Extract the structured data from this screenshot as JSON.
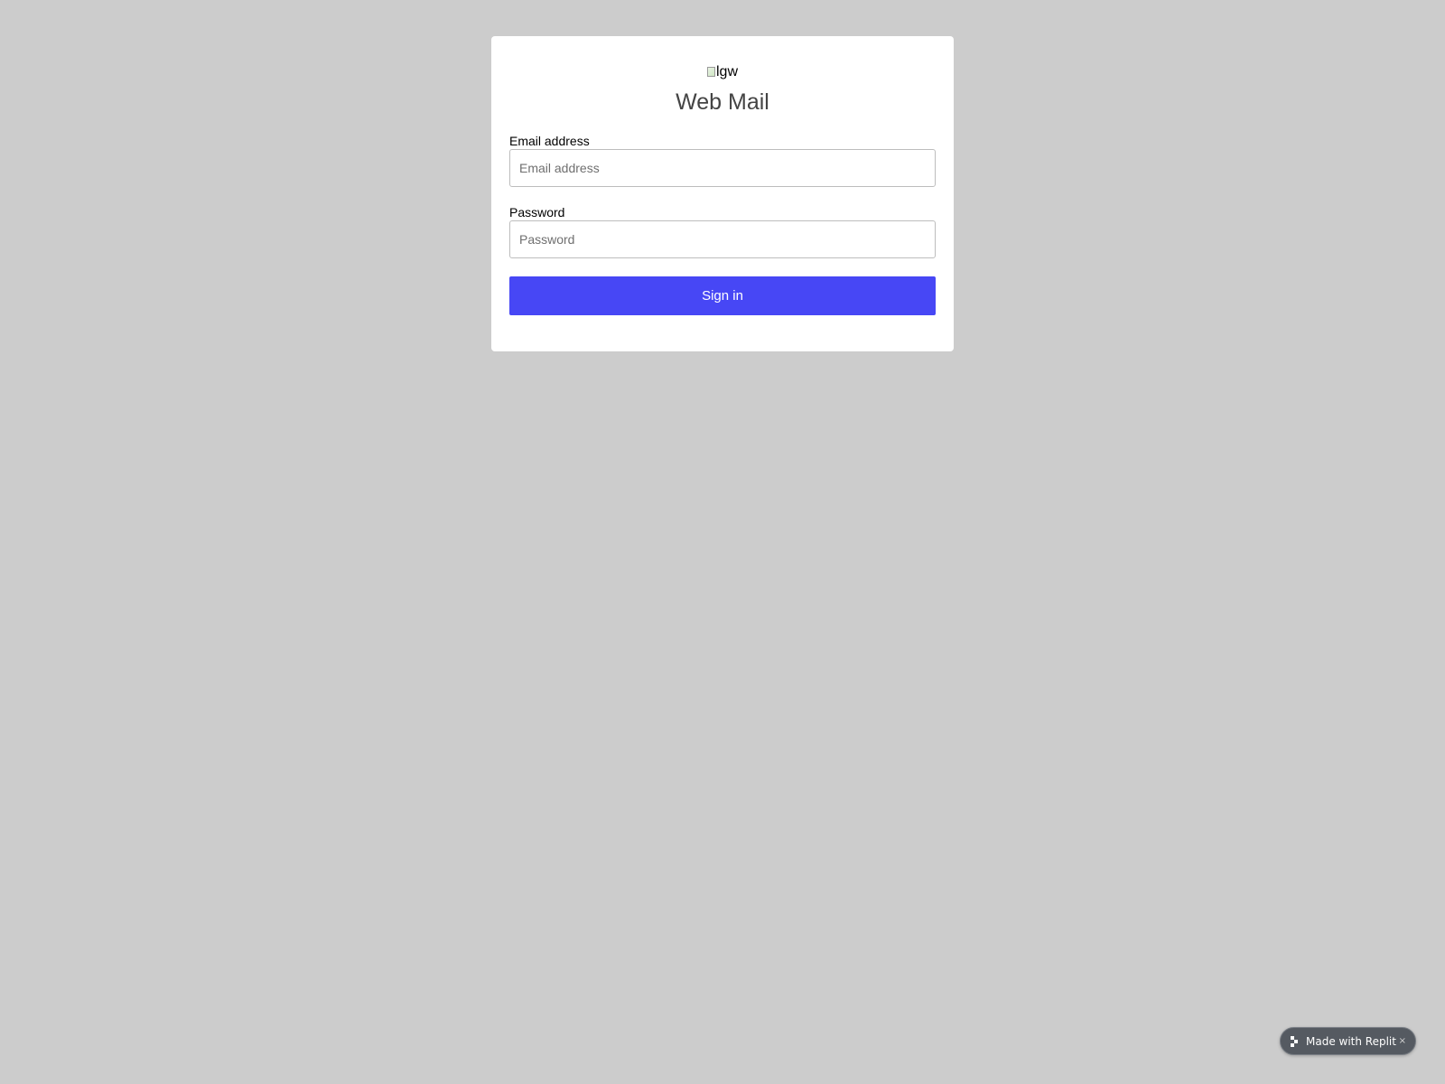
{
  "login": {
    "logo_alt": "lgw",
    "title": "Web Mail",
    "email": {
      "label": "Email address",
      "placeholder": "Email address",
      "value": ""
    },
    "password": {
      "label": "Password",
      "placeholder": "Password",
      "value": ""
    },
    "submit_label": "Sign in",
    "accent_color": "#4747f5"
  },
  "badge": {
    "text": "Made with Replit",
    "close": "×",
    "icon": "replit-logo-icon"
  }
}
